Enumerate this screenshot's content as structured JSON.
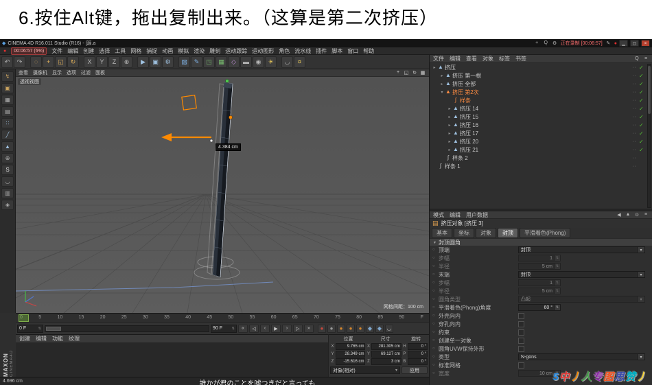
{
  "page": {
    "heading": "6.按住Alt键，拖出复制出来。（这算是第二次挤压）"
  },
  "titlebar": {
    "app_icon": "◆",
    "title": "CINEMA 4D R16.011 Studio (R16) - [源.a",
    "record_dot": "●",
    "record_badge": "00:06:57 (6%)",
    "right_icons": [
      {
        "name": "capture-icon",
        "glyph": "+"
      },
      {
        "name": "search-icon",
        "glyph": "Q"
      },
      {
        "name": "settings-icon",
        "glyph": "⚙"
      }
    ],
    "recording_text": "正在录制 [00:06:57]",
    "pencil": "✎",
    "win_min": "▁",
    "win_max": "▢",
    "win_close": "×"
  },
  "menubar": {
    "items": [
      "文件",
      "编辑",
      "创建",
      "选择",
      "工具",
      "网格",
      "捕捉",
      "动画",
      "模拟",
      "渲染",
      "雕刻",
      "运动跟踪",
      "运动图形",
      "角色",
      "流水线",
      "插件",
      "脚本",
      "窗口",
      "帮助"
    ]
  },
  "toolbar": {
    "icons": [
      {
        "name": "undo-icon",
        "glyph": "↶"
      },
      {
        "name": "redo-icon",
        "glyph": "↷"
      },
      {
        "type": "sep"
      },
      {
        "name": "live-selection-icon",
        "glyph": "◌",
        "color": "#e0b05a"
      },
      {
        "name": "move-tool-icon",
        "glyph": "+",
        "color": "#e0b05a"
      },
      {
        "name": "scale-tool-icon",
        "glyph": "◱",
        "color": "#e0b05a"
      },
      {
        "name": "rotate-tool-icon",
        "glyph": "↻",
        "color": "#e0b05a"
      },
      {
        "type": "sep"
      },
      {
        "name": "x-axis-lock-icon",
        "glyph": "X"
      },
      {
        "name": "y-axis-lock-icon",
        "glyph": "Y"
      },
      {
        "name": "z-axis-lock-icon",
        "glyph": "Z"
      },
      {
        "name": "coord-system-icon",
        "glyph": "⊕"
      },
      {
        "type": "sep"
      },
      {
        "name": "render-view-icon",
        "glyph": "▶",
        "color": "#9fc1e0"
      },
      {
        "name": "render-picture-viewer-icon",
        "glyph": "▣",
        "color": "#9fc1e0"
      },
      {
        "name": "render-settings-icon",
        "glyph": "⚙",
        "color": "#9fc1e0"
      },
      {
        "type": "sep"
      },
      {
        "name": "primitive-cube-icon",
        "glyph": "▧",
        "color": "#7fb2e5"
      },
      {
        "name": "spline-pen-icon",
        "glyph": "✎",
        "color": "#7fb2e5"
      },
      {
        "name": "subdivision-surface-icon",
        "glyph": "◳",
        "color": "#79c06f"
      },
      {
        "name": "array-icon",
        "glyph": "▦",
        "color": "#79c06f"
      },
      {
        "name": "deformer-icon",
        "glyph": "◇",
        "color": "#c08fd8"
      },
      {
        "name": "floor-icon",
        "glyph": "▬"
      },
      {
        "name": "camera-icon",
        "glyph": "◉"
      },
      {
        "name": "light-icon",
        "glyph": "☀",
        "color": "#e4c65a"
      },
      {
        "type": "sep"
      },
      {
        "name": "snap-magnet-icon",
        "glyph": "◡"
      },
      {
        "name": "bulb-icon",
        "glyph": "¤",
        "color": "#e4c65a"
      }
    ]
  },
  "side_tools": {
    "icons": [
      {
        "name": "make-editable-icon",
        "glyph": "↯",
        "color": "#c9a35f"
      },
      {
        "name": "model-mode-icon",
        "glyph": "▣",
        "color": "#c9a35f"
      },
      {
        "name": "texture-mode-icon",
        "glyph": "▦",
        "color": "#b0b0b0"
      },
      {
        "name": "workplane-mode-icon",
        "glyph": "▤",
        "color": "#b0b0b0"
      },
      {
        "name": "points-mode-icon",
        "glyph": "∷",
        "color": "#9fc1e0"
      },
      {
        "name": "edges-mode-icon",
        "glyph": "╱",
        "color": "#9fc1e0"
      },
      {
        "name": "polygons-mode-icon",
        "glyph": "▲",
        "color": "#9fc1e0"
      },
      {
        "name": "enable-axis-icon",
        "glyph": "⊕",
        "color": "#b0b0b0"
      },
      {
        "name": "viewport-solo-icon",
        "glyph": "S",
        "color": "#e0e0e0"
      },
      {
        "name": "snap-enable-icon",
        "glyph": "◡",
        "color": "#b0b0b0"
      },
      {
        "name": "workplane-lock-icon",
        "glyph": "▥",
        "color": "#b0b0b0"
      },
      {
        "name": "quantize-icon",
        "glyph": "◈",
        "color": "#b0b0b0"
      }
    ]
  },
  "viewport": {
    "view_label": "透视视图",
    "menus": [
      "查看",
      "摄像机",
      "显示",
      "选项",
      "过滤",
      "面板"
    ],
    "corner_icons": [
      {
        "name": "pan-view-icon",
        "glyph": "+"
      },
      {
        "name": "zoom-view-icon",
        "glyph": "◱"
      },
      {
        "name": "rotate-view-icon",
        "glyph": "↻"
      },
      {
        "name": "toggle-view-icon",
        "glyph": "▦"
      }
    ],
    "measurement": "4.384 cm",
    "grid_label": "网格间距：100 cm"
  },
  "timeline": {
    "ticks": [
      "0",
      "5",
      "10",
      "15",
      "20",
      "25",
      "30",
      "35",
      "40",
      "45",
      "50",
      "55",
      "60",
      "65",
      "70",
      "75",
      "80",
      "85",
      "90",
      "F"
    ],
    "current": "0 F",
    "end": "90 F",
    "step_glyph": "⇅",
    "transport": [
      {
        "name": "goto-start-button",
        "glyph": "«"
      },
      {
        "name": "prev-key-button",
        "glyph": "◁"
      },
      {
        "name": "prev-frame-button",
        "glyph": "‹"
      },
      {
        "name": "play-button",
        "glyph": "▶"
      },
      {
        "name": "next-frame-button",
        "glyph": "›"
      },
      {
        "name": "next-key-button",
        "glyph": "▷"
      },
      {
        "name": "goto-end-button",
        "glyph": "»"
      }
    ],
    "records": [
      {
        "name": "record-keyframe-button",
        "glyph": "●",
        "color": "#c8473c"
      },
      {
        "name": "autokey-button",
        "glyph": "●",
        "color": "#9a9a9a"
      },
      {
        "name": "record-position-button",
        "glyph": "●",
        "color": "#d5862c"
      },
      {
        "name": "record-scale-button",
        "glyph": "●",
        "color": "#d5862c"
      },
      {
        "name": "record-rotation-button",
        "glyph": "●",
        "color": "#d5862c"
      },
      {
        "name": "record-parameter-button",
        "glyph": "◆",
        "color": "#7fa6cc"
      },
      {
        "name": "record-point-level-button",
        "glyph": "◆",
        "color": "#7fa6cc"
      },
      {
        "name": "keyframe-selection-button",
        "glyph": "◡",
        "color": "#b0b0b0"
      }
    ]
  },
  "materials": {
    "menus": [
      "创建",
      "编辑",
      "功能",
      "纹理"
    ]
  },
  "coords": {
    "headers": [
      "位置",
      "尺寸",
      "旋转"
    ],
    "rows": [
      {
        "a1": "X",
        "pos": "9.765 cm",
        "a2": "X",
        "size": "281.305 cm",
        "a3": "H",
        "rot": "0 °"
      },
      {
        "a1": "Y",
        "pos": "28.349 cm",
        "a2": "Y",
        "size": "69.127 cm",
        "a3": "P",
        "rot": "0 °"
      },
      {
        "a1": "Z",
        "pos": "-15.616 cm",
        "a2": "Z",
        "size": "3 cm",
        "a3": "B",
        "rot": "0 °"
      }
    ],
    "mode": "对象(相对)",
    "dd_glyph": "▾",
    "apply": "应用"
  },
  "object_manager": {
    "menus": [
      "文件",
      "编辑",
      "查看",
      "对象",
      "标签",
      "书签"
    ],
    "tools": [
      {
        "name": "om-search-icon",
        "glyph": "Q"
      },
      {
        "name": "om-filter-icon",
        "glyph": "≡"
      }
    ],
    "dots": "··",
    "check_glyph": "✓",
    "items": [
      {
        "label": "挤压",
        "depth": 0,
        "arrow": "▸",
        "icon": "▲",
        "icon_color": "#9fc1e0",
        "check": true
      },
      {
        "label": "挤压 第一根",
        "depth": 1,
        "arrow": "▸",
        "icon": "▲",
        "icon_color": "#9fc1e0",
        "check": true
      },
      {
        "label": "挤压 全部",
        "depth": 1,
        "arrow": "▸",
        "icon": "▲",
        "icon_color": "#9fc1e0",
        "check": true
      },
      {
        "label": "挤压 第2次",
        "depth": 1,
        "arrow": "▾",
        "icon": "▲",
        "icon_color": "#ff8c42",
        "selected": true,
        "check": true
      },
      {
        "label": "样条",
        "depth": 2,
        "arrow": "",
        "icon": "∫",
        "icon_color": "#ff8c42",
        "selected": true,
        "check": true
      },
      {
        "label": "挤压 14",
        "depth": 2,
        "arrow": "▸",
        "icon": "▲",
        "icon_color": "#9fc1e0",
        "check": true
      },
      {
        "label": "挤压 15",
        "depth": 2,
        "arrow": "▸",
        "icon": "▲",
        "icon_color": "#9fc1e0",
        "check": true
      },
      {
        "label": "挤压 16",
        "depth": 2,
        "arrow": "▸",
        "icon": "▲",
        "icon_color": "#9fc1e0",
        "check": true
      },
      {
        "label": "挤压 17",
        "depth": 2,
        "arrow": "▸",
        "icon": "▲",
        "icon_color": "#9fc1e0",
        "check": true
      },
      {
        "label": "挤压 20",
        "depth": 2,
        "arrow": "▸",
        "icon": "▲",
        "icon_color": "#9fc1e0",
        "check": true
      },
      {
        "label": "挤压 21",
        "depth": 2,
        "arrow": "▸",
        "icon": "▲",
        "icon_color": "#9fc1e0",
        "check": true
      },
      {
        "label": "样条 2",
        "depth": 1,
        "arrow": "",
        "icon": "∫",
        "icon_color": "#c9c9c9",
        "check": false
      },
      {
        "label": "样条 1",
        "depth": 0,
        "arrow": "",
        "icon": "∫",
        "icon_color": "#c9c9c9",
        "check": false
      }
    ]
  },
  "attributes": {
    "tabs": [
      "模式",
      "编辑",
      "用户数据"
    ],
    "tools": [
      {
        "name": "am-back-icon",
        "glyph": "◀"
      },
      {
        "name": "am-up-icon",
        "glyph": "▲"
      },
      {
        "name": "am-lock-icon",
        "glyph": "⊙"
      },
      {
        "name": "am-menu-icon",
        "glyph": "≡"
      }
    ],
    "object_icon": "▤",
    "title": "挤压对象 [挤压 3]",
    "subtabs": [
      {
        "label": "基本"
      },
      {
        "label": "坐标"
      },
      {
        "label": "对象"
      },
      {
        "label": "封顶",
        "active": true
      },
      {
        "label": "平滑着色(Phong)"
      }
    ],
    "section": "封顶圆角",
    "tri_glyph": "▾",
    "dot_glyph": "○",
    "dd_glyph": "▾",
    "step_glyph": "⇅",
    "rows": [
      {
        "label": "顶端",
        "control": "select",
        "value": "封顶"
      },
      {
        "label": "步幅",
        "control": "number",
        "value": "1",
        "dim": true
      },
      {
        "label": "半径",
        "control": "number",
        "value": "5 cm",
        "dim": true
      },
      {
        "label": "末端",
        "control": "select",
        "value": "封顶"
      },
      {
        "label": "步幅",
        "control": "number",
        "value": "1",
        "dim": true
      },
      {
        "label": "半径",
        "control": "number",
        "value": "5 cm",
        "dim": true
      },
      {
        "label": "圆角类型",
        "control": "select",
        "value": "凸起",
        "dim": true
      },
      {
        "label": "平滑着色(Phong)角度",
        "control": "number",
        "value": "60 °"
      },
      {
        "label": "外壳向内",
        "control": "checkbox"
      },
      {
        "label": "穿孔向内",
        "control": "checkbox"
      },
      {
        "label": "约束",
        "control": "checkbox"
      },
      {
        "label": "创建单一对象",
        "control": "checkbox"
      },
      {
        "label": "圆角UVW保持外形",
        "control": "checkbox"
      },
      {
        "label": "类型",
        "control": "select",
        "value": "N-gons"
      },
      {
        "label": "标准网格",
        "control": "checkbox"
      },
      {
        "label": "宽度",
        "control": "number",
        "value": "10 cm",
        "dim": true
      }
    ]
  },
  "status": {
    "left": "4.696 cm",
    "subtitle": "誰かが君のことを嘘つきだと言っても"
  },
  "branding": {
    "maxon": "MAXON",
    "cinema": "CINEMA4D"
  },
  "watermark": {
    "chars": [
      {
        "ch": "5",
        "color": "#1e88e5"
      },
      {
        "ch": "中",
        "color": "#e53935"
      },
      {
        "ch": "丿",
        "color": "#fb8c00"
      },
      {
        "ch": "人",
        "color": "#43a047"
      },
      {
        "ch": "专",
        "color": "#8e24aa"
      },
      {
        "ch": "图",
        "color": "#f4511e"
      },
      {
        "ch": "思",
        "color": "#3949ab"
      },
      {
        "ch": "赞",
        "color": "#00acc1"
      },
      {
        "ch": "丿",
        "color": "#fdd835"
      }
    ]
  }
}
